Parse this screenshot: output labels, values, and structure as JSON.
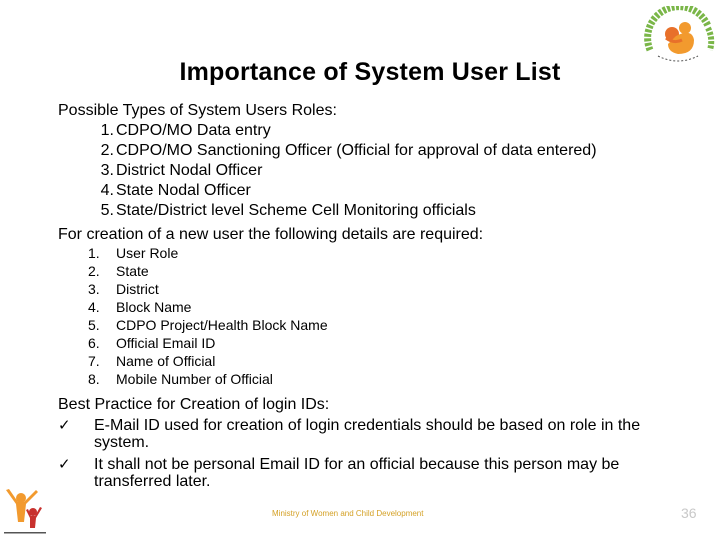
{
  "slide": {
    "title": "Importance of System User List",
    "roles_heading": "Possible Types of System Users Roles:",
    "roles": [
      {
        "num": "1.",
        "text": "CDPO/MO Data entry"
      },
      {
        "num": "2.",
        "text": "CDPO/MO Sanctioning Officer (Official for approval of data entered)"
      },
      {
        "num": "3.",
        "text": "District Nodal Officer"
      },
      {
        "num": "4.",
        "text": "State Nodal Officer"
      },
      {
        "num": "5.",
        "text": "State/District level Scheme Cell Monitoring officials"
      }
    ],
    "details_heading": "For creation of a new user the following details are required:",
    "details": [
      {
        "num": "1.",
        "text": "User Role"
      },
      {
        "num": "2.",
        "text": "State"
      },
      {
        "num": "3.",
        "text": "District"
      },
      {
        "num": "4.",
        "text": "Block Name"
      },
      {
        "num": "5.",
        "text": "CDPO Project/Health Block Name"
      },
      {
        "num": "6.",
        "text": "Official Email ID"
      },
      {
        "num": "7.",
        "text": "Name of Official"
      },
      {
        "num": "8.",
        "text": "Mobile Number of Official"
      }
    ],
    "practice_heading": "Best Practice for Creation of login IDs:",
    "practices": [
      {
        "icon": "check-icon",
        "glyph": "✓",
        "text": "E-Mail ID used for creation of login credentials should be based on role in the system."
      },
      {
        "icon": "check-icon",
        "glyph": "✓",
        "text": "It shall not be personal Email ID for an official because this person may be transferred later."
      }
    ]
  },
  "footer": {
    "ministry": "Ministry of Women and Child Development",
    "page_number": "36"
  },
  "logos": {
    "top_right": "scheme-emblem-logo",
    "bottom_left": "family-figures-logo"
  },
  "colors": {
    "footer_text": "#d4a126",
    "page_number": "#c8c8c8",
    "logo_green": "#7ab648",
    "logo_orange": "#f29a2e",
    "logo_dark_orange": "#e8702a",
    "logo_red": "#c8312e"
  }
}
